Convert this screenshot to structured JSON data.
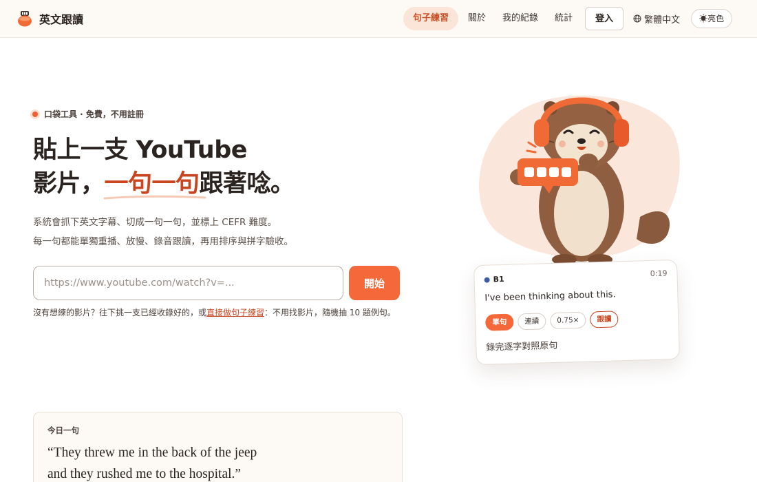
{
  "header": {
    "brand": "英文跟讀",
    "nav": {
      "practice": "句子練習",
      "about": "關於",
      "history": "我的紀錄",
      "stats": "統計"
    },
    "login_label": "登入",
    "language_label": "繁體中文",
    "theme_label": "☀亮色"
  },
  "hero": {
    "eyebrow": "口袋工具 · 免費，不用註冊",
    "headline_line1": "貼上一支 YouTube",
    "headline_line2_prefix": "影片，",
    "headline_line2_accent": "一句一句",
    "headline_line2_suffix": "跟著唸。",
    "desc_line1": "系統會抓下英文字幕、切成一句一句，並標上 CEFR 難度。",
    "desc_line2": "每一句都能單獨重播、放慢、錄音跟讀，再用排序與拼字驗收。",
    "url_placeholder": "https://www.youtube.com/watch?v=...",
    "start_label": "開始",
    "hint_prefix": "沒有想練的影片？往下挑一支已經收錄好的，或",
    "hint_link": "直接做句子練習",
    "hint_suffix": "：不用找影片，隨機抽 10 題例句。"
  },
  "preview": {
    "level": "B1",
    "time": "0:19",
    "sentence": "I've been thinking about this.",
    "chips": [
      "單句",
      "連續",
      "0.75×",
      "跟讀"
    ],
    "footer": "錄完逐字對照原句"
  },
  "daily": {
    "label": "今日一句",
    "quote_line1": "“They threw me in the back of the jeep",
    "quote_line2": "and they rushed me to the hospital.”"
  },
  "colors": {
    "accent": "#f4683a",
    "accent_dark": "#c8451f",
    "header_bg": "#fdf9f5",
    "level_b1": "#3d5ea6"
  },
  "icons": {
    "brand": "tomato-logo-icon",
    "language": "globe-icon",
    "theme": "sun-icon",
    "mascot": "otter-headphones-illustration"
  }
}
